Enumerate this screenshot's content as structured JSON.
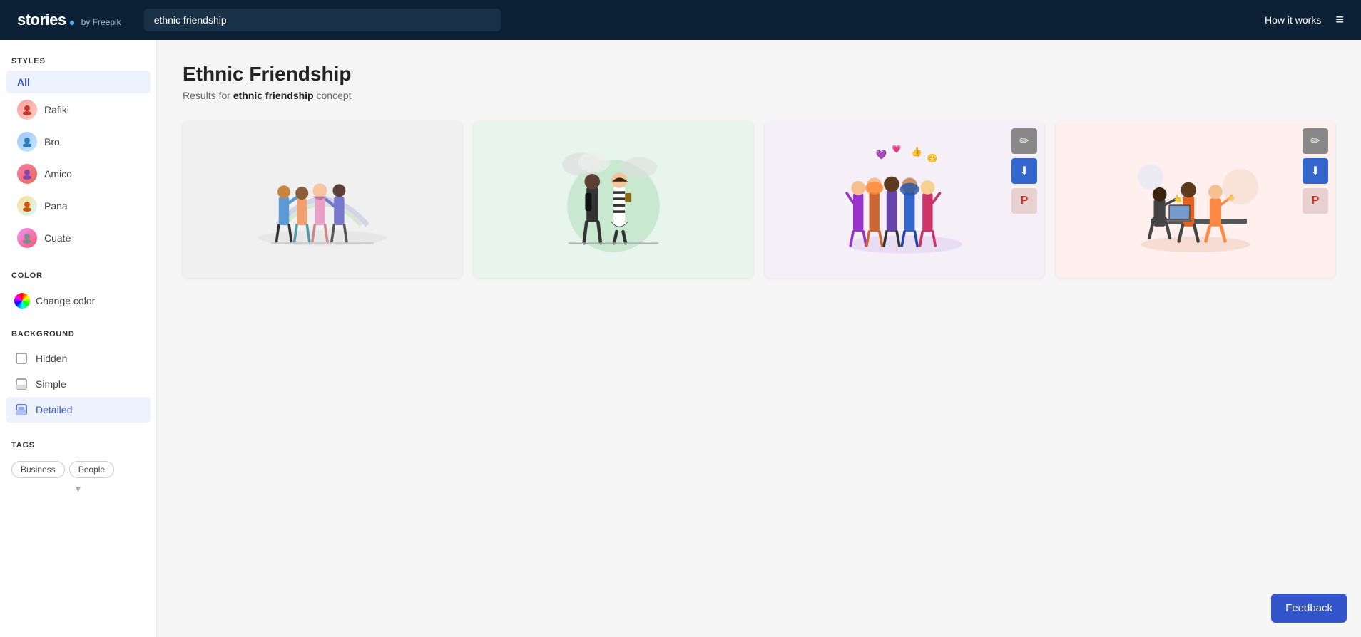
{
  "header": {
    "logo_text": "stories",
    "logo_suffix": "by Freepik",
    "search_value": "ethnic friendship",
    "how_it_works": "How it works"
  },
  "sidebar": {
    "styles_label": "STYLES",
    "style_items": [
      {
        "id": "all",
        "label": "All",
        "active": true,
        "has_avatar": false
      },
      {
        "id": "rafiki",
        "label": "Rafiki",
        "active": false,
        "has_avatar": true,
        "avatar_class": "avatar-rafiki"
      },
      {
        "id": "bro",
        "label": "Bro",
        "active": false,
        "has_avatar": true,
        "avatar_class": "avatar-bro"
      },
      {
        "id": "amico",
        "label": "Amico",
        "active": false,
        "has_avatar": true,
        "avatar_class": "avatar-amico"
      },
      {
        "id": "pana",
        "label": "Pana",
        "active": false,
        "has_avatar": true,
        "avatar_class": "avatar-pana"
      },
      {
        "id": "cuate",
        "label": "Cuate",
        "active": false,
        "has_avatar": true,
        "avatar_class": "avatar-cuate"
      }
    ],
    "color_label": "COLOR",
    "change_color_label": "Change color",
    "background_label": "BACKGROUND",
    "bg_items": [
      {
        "id": "hidden",
        "label": "Hidden",
        "active": false
      },
      {
        "id": "simple",
        "label": "Simple",
        "active": false
      },
      {
        "id": "detailed",
        "label": "Detailed",
        "active": true
      }
    ],
    "tags_label": "TAGS",
    "tags": [
      "Business",
      "People"
    ]
  },
  "main": {
    "page_title": "Ethnic Friendship",
    "results_prefix": "Results for ",
    "results_keyword": "ethnic friendship",
    "results_suffix": " concept",
    "illustrations": [
      {
        "id": 1,
        "bg": "#f0f0f0",
        "show_actions": false
      },
      {
        "id": 2,
        "bg": "#e8f5ee",
        "show_actions": false
      },
      {
        "id": 3,
        "bg": "#f5f0f8",
        "show_actions": true
      },
      {
        "id": 4,
        "bg": "#fff0ee",
        "show_actions": true
      }
    ]
  },
  "feedback": {
    "label": "Feedback"
  },
  "icons": {
    "edit": "✏",
    "download": "⬇",
    "pinterest": "P",
    "hamburger": "≡",
    "hidden_bg": "□",
    "simple_bg": "◱",
    "detailed_bg": "▣"
  }
}
